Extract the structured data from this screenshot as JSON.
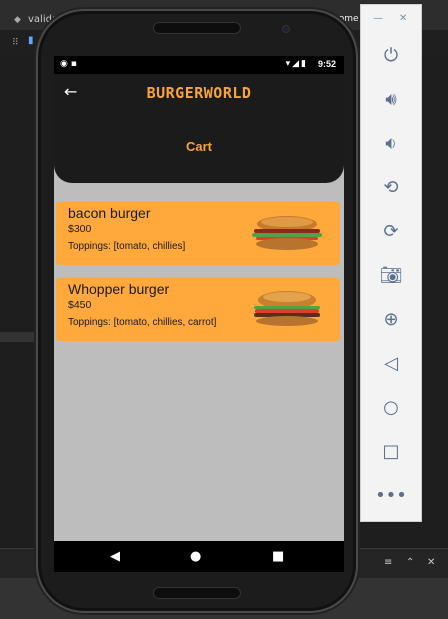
{
  "ide": {
    "tab_label": "validators.d",
    "tab2_label": "home"
  },
  "status_bar": {
    "time": "9:52"
  },
  "app": {
    "brand": "BURGERWORLD",
    "page_title": "Cart",
    "cart_items": [
      {
        "name": "bacon burger",
        "price": "$300",
        "toppings": "Toppings: [tomato, chillies]"
      },
      {
        "name": "Whopper burger",
        "price": "$450",
        "toppings": "Toppings: [tomato, chillies, carrot]"
      }
    ]
  },
  "colors": {
    "accent": "#f7a43b",
    "card": "#ffa93c",
    "appbar": "#1b1b1b",
    "screen_bg": "#bdbdbd"
  },
  "icons": {
    "back": "arrow-left-icon",
    "emulator_tools": [
      "power-icon",
      "volume-up-icon",
      "volume-down-icon",
      "rotate-left-icon",
      "rotate-right-icon",
      "camera-icon",
      "zoom-icon",
      "back-icon",
      "home-icon",
      "overview-icon",
      "more-icon"
    ]
  }
}
